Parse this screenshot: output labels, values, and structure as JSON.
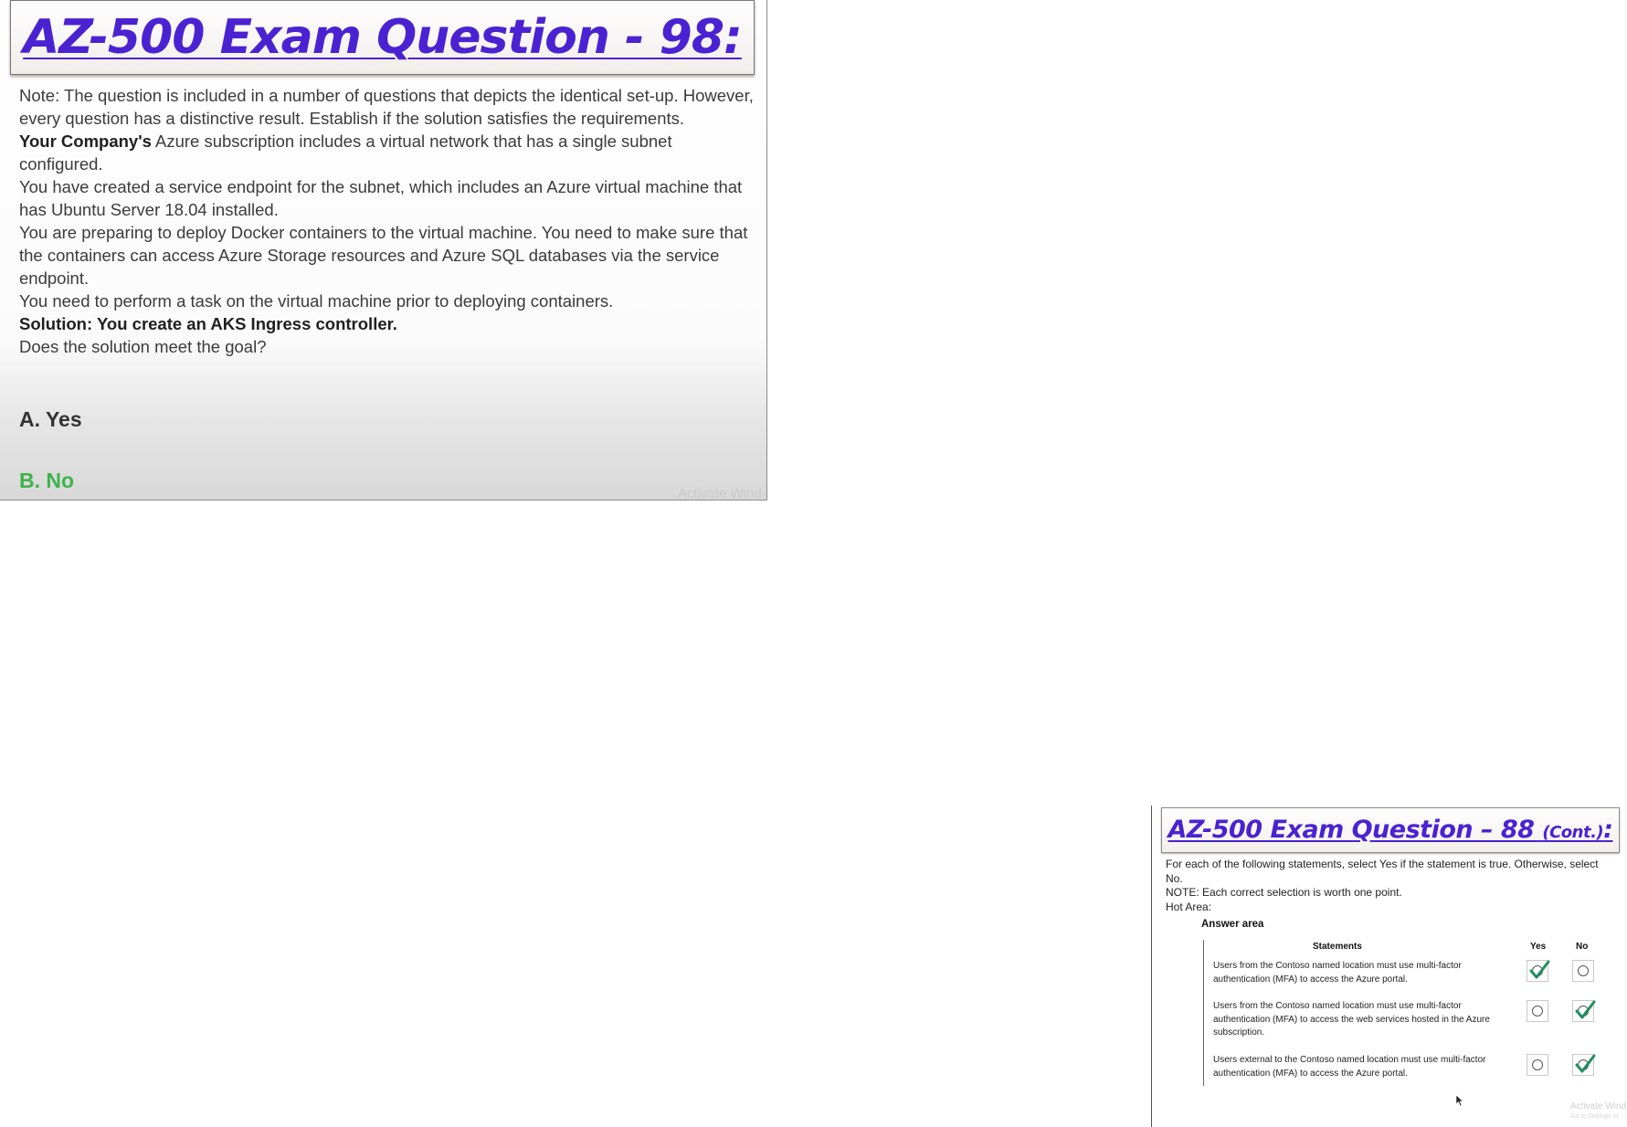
{
  "slide1": {
    "title": "AZ-500 Exam Question - 98:",
    "paragraphs": [
      {
        "prefix": "",
        "text": "Note: The question is included in a number of questions that depicts the identical set-up. However, every question has a distinctive result. Establish if the solution satisfies the requirements."
      },
      {
        "prefix": "Your Company's",
        "text": " Azure subscription includes a virtual network that has a single subnet configured."
      },
      {
        "prefix": "",
        "text": "You have created a service endpoint for the subnet, which includes an Azure virtual machine that has Ubuntu Server 18.04 installed."
      },
      {
        "prefix": "",
        "text": "You are preparing to deploy Docker containers to the virtual machine. You need to make sure that the containers can access Azure Storage resources and Azure SQL databases via the service endpoint."
      },
      {
        "prefix": "",
        "text": "You need to perform a task on the virtual machine prior to deploying containers."
      }
    ],
    "solution": "Solution: You create an AKS Ingress controller.",
    "question": "Does the solution meet the goal?",
    "option_a": "A. Yes",
    "option_b": "B. No",
    "watermark": "Activate Wind"
  },
  "slide2": {
    "title_main": "AZ-500 Exam Question – 88 ",
    "title_cont": "(Cont.)",
    "title_colon": ":",
    "intro": [
      "For each of the following statements, select Yes if the statement is true. Otherwise, select No.",
      "NOTE: Each correct selection is worth one point.",
      "Hot Area:"
    ],
    "answer_area_label": "Answer area",
    "col_statements": "Statements",
    "col_yes": "Yes",
    "col_no": "No",
    "rows": [
      {
        "text": "Users from the Contoso named location must use multi-factor authentication (MFA) to access the Azure portal.",
        "selected": "Yes"
      },
      {
        "text": "Users from the Contoso named location must use multi-factor authentication (MFA) to access the web services hosted in the Azure subscription.",
        "selected": "No"
      },
      {
        "text": "Users external to the Contoso named location must use multi-factor authentication (MFA) to access the Azure portal.",
        "selected": "No"
      }
    ],
    "watermark_line1": "Activate Wind",
    "watermark_line2": "Go to Settings to"
  },
  "colors": {
    "title": "#4b22d2",
    "correct_answer": "#3cb34a",
    "checkmark": "#1f8f5f"
  },
  "icons": [
    "checkmark-icon",
    "radio-circle-icon",
    "mouse-cursor-icon"
  ]
}
